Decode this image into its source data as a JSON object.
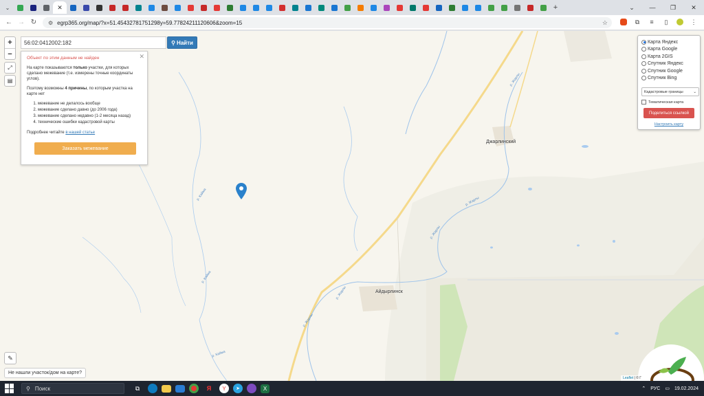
{
  "browser": {
    "favicons": [
      "#34a853",
      "#1a237e",
      "#5f6368",
      "#e53935",
      "#1565c0",
      "#3949ab",
      "#333333",
      "#c62828",
      "#c62828",
      "#00838f",
      "#1e88e5",
      "#6d4c41",
      "#1e88e5",
      "#e53935",
      "#c62828",
      "#e53935",
      "#2e7d32",
      "#1e88e5",
      "#1e88e5",
      "#1e88e5",
      "#d32f2f",
      "#00838f",
      "#1976d2",
      "#00897b",
      "#1976d2",
      "#43a047",
      "#f57c00",
      "#1e88e5",
      "#ab47bc",
      "#e53935",
      "#00796b",
      "#e53935",
      "#1565c0",
      "#2e7d32",
      "#1e88e5",
      "#1e88e5",
      "#43a047",
      "#43a047",
      "#757575",
      "#c62828",
      "#43a047"
    ],
    "active_tab_index": 3,
    "url": "egrp365.org/map/?x=51.45432781751298y=59.77824211120606&zoom=15"
  },
  "search": {
    "value": "56:02:0412002:182",
    "button_label": "Найти"
  },
  "info_popup": {
    "error_title": "Объект по этим данным не найден",
    "intro_before": "На карте показываются ",
    "intro_bold": "только",
    "intro_after": " участки, для которых сделано межевание (т.е. измерены точные координаты углов).",
    "reasons_before": "Поэтому возможны ",
    "reasons_bold": "4 причины",
    "reasons_after": ", по которым участка на карте нет",
    "reasons": [
      "межевание не делалось вообще",
      "межевание сделано давно (до 2006 года)",
      "межевание сделано недавно (1-2 месяца назад)",
      "технические ошибки кадастровой карты"
    ],
    "more_before": "Подробнее читайте ",
    "more_link": "в нашей статье",
    "order_button": "Заказать межевание"
  },
  "layers": {
    "options": [
      "Карта Яндекс",
      "Карта Google",
      "Карта 2GIS",
      "Спутник Яндекс",
      "Спутник Google",
      "Спутник Bing"
    ],
    "selected_index": 0,
    "select_value": "Кадастровые границы",
    "thematic_label": "Тематическая карта",
    "share_button": "Поделиться ссылкой",
    "configure_link": "Настроить карту"
  },
  "map": {
    "places": [
      "Джарлинский",
      "Айдырлинск"
    ],
    "river_labels": [
      "р. Жарлы",
      "р. Жарлы",
      "р. Жарлы",
      "р. Жарлы",
      "р. Жарлы",
      "р. Кайма",
      "р. Кайма",
      "р. Кайма"
    ],
    "not_found_button": "Не нашли участок/дом на карте?",
    "attribution_link": "Leaflet",
    "attribution_rest": " | © Г",
    "attribution_tail": "ᴋ"
  },
  "taskbar": {
    "search_placeholder": "Поиск",
    "lang": "РУС",
    "date": "19.02.2024"
  }
}
